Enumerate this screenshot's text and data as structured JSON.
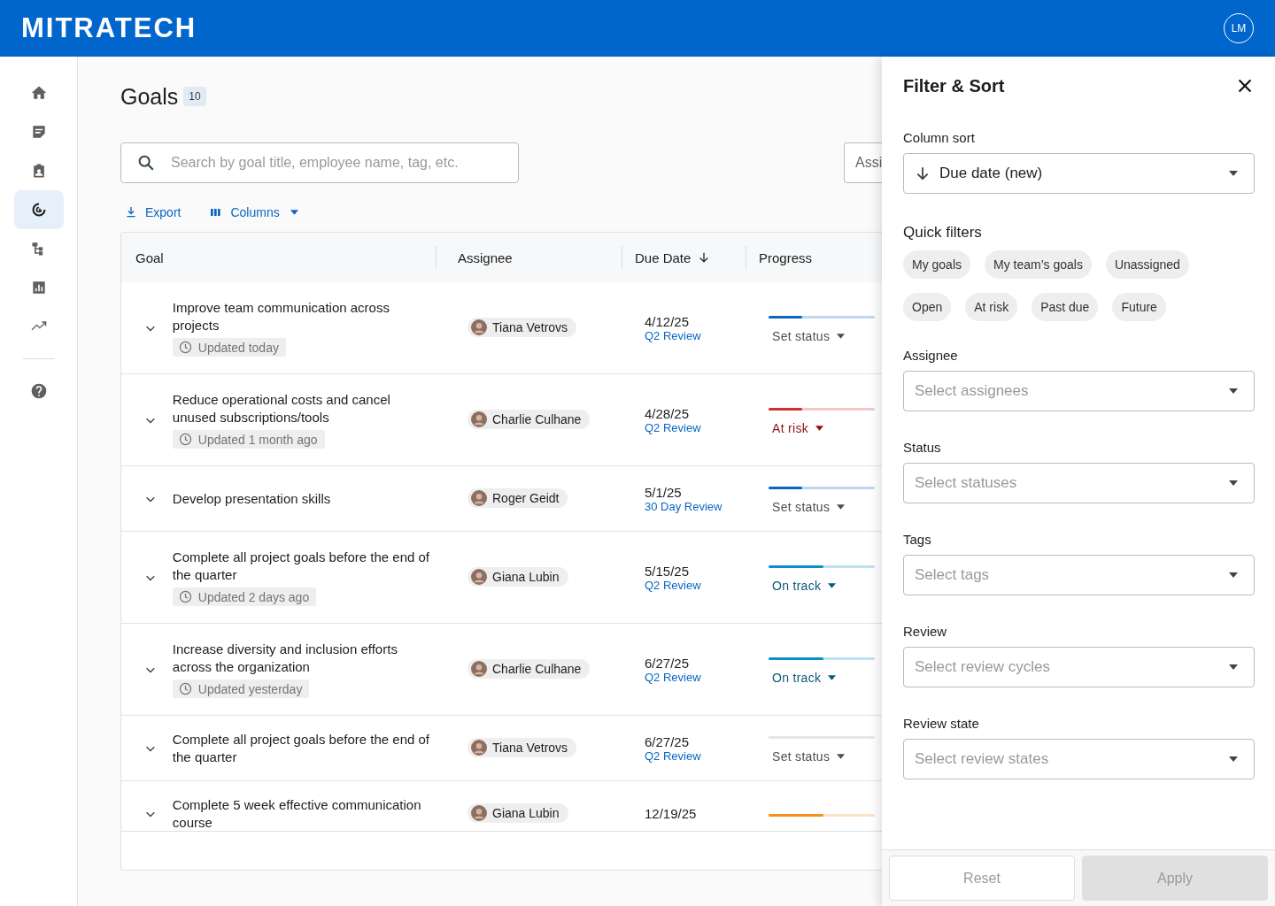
{
  "header": {
    "logo": "MITRATECH",
    "user_initials": "LM"
  },
  "sidebar": {
    "items": [
      {
        "selected": false
      },
      {
        "selected": false
      },
      {
        "selected": false
      },
      {
        "selected": true
      },
      {
        "selected": false
      },
      {
        "selected": false
      },
      {
        "selected": false
      }
    ],
    "footer_items": [
      {
        "selected": false
      }
    ]
  },
  "page": {
    "title": "Goals",
    "count": "10"
  },
  "search": {
    "placeholder": "Search by goal title, employee name, tag, etc."
  },
  "assignee_filter": {
    "value": "Assi"
  },
  "actions": {
    "export": "Export",
    "columns": "Columns"
  },
  "table": {
    "columns": [
      "Goal",
      "Assignee",
      "Due Date",
      "Progress"
    ],
    "rows": [
      {
        "goal": "Improve team communication across projects",
        "updated": "Updated today",
        "assignee": "Tiana Vetrovs",
        "due": "4/12/25",
        "review": "Q2 Review",
        "level": 0.32,
        "color": "#0a66c2",
        "status": "Set status",
        "kind": "none"
      },
      {
        "goal": "Reduce operational costs and cancel unused subscriptions/tools",
        "updated": "Updated 1 month ago",
        "assignee": "Charlie Culhane",
        "due": "4/28/25",
        "review": "Q2 Review",
        "level": 0.32,
        "color": "#d32f2f",
        "status": "At risk",
        "kind": "at_risk"
      },
      {
        "goal": "Develop presentation skills",
        "assignee": "Roger Geidt",
        "due": "5/1/25",
        "review": "30 Day Review",
        "level": 0.32,
        "color": "#0a66c2",
        "status": "Set status",
        "kind": "none"
      },
      {
        "goal": "Complete all project goals before the end of the quarter",
        "updated": "Updated 2 days ago",
        "assignee": "Giana Lubin",
        "due": "5/15/25",
        "review": "Q2 Review",
        "level": 0.52,
        "color": "#0b8fc9",
        "status": "On track",
        "kind": "on_track"
      },
      {
        "goal": "Increase diversity and inclusion efforts across the organization",
        "updated": "Updated yesterday",
        "assignee": "Charlie Culhane",
        "due": "6/27/25",
        "review": "Q2 Review",
        "level": 0.52,
        "color": "#0b8fc9",
        "status": "On track",
        "kind": "on_track"
      },
      {
        "goal": "Complete all project goals before the end of the quarter",
        "assignee": "Tiana Vetrovs",
        "due": "6/27/25",
        "review": "Q2 Review",
        "status": "Set status",
        "kind": "none"
      },
      {
        "goal": "Complete 5 week effective communication course",
        "assignee": "Giana Lubin",
        "due": "12/19/25",
        "level": 0.52,
        "color": "#f5901e"
      }
    ]
  },
  "panel": {
    "title": "Filter & Sort",
    "sort": {
      "label": "Column sort",
      "value": "Due date (new)"
    },
    "quick_filters": {
      "label": "Quick filters",
      "chips": [
        {
          "label": "My goals",
          "selected": false
        },
        {
          "label": "My team’s goals",
          "selected": false
        },
        {
          "label": "Unassigned",
          "selected": false
        },
        {
          "label": "Open",
          "selected": false
        },
        {
          "label": "At risk",
          "selected": false
        },
        {
          "label": "Past due",
          "selected": false
        },
        {
          "label": "Future",
          "selected": false
        }
      ]
    },
    "filters": [
      {
        "label": "Assignee",
        "placeholder": "Select assignees"
      },
      {
        "label": "Status",
        "placeholder": "Select statuses"
      },
      {
        "label": "Tags",
        "placeholder": "Select tags"
      },
      {
        "label": "Review",
        "placeholder": "Select review cycles"
      },
      {
        "label": "Review state",
        "placeholder": "Select review states"
      }
    ],
    "buttons": [
      {
        "label": "Reset",
        "kind": "secondary",
        "disabled": true
      },
      {
        "label": "Apply",
        "kind": "primary",
        "disabled": true
      }
    ]
  }
}
